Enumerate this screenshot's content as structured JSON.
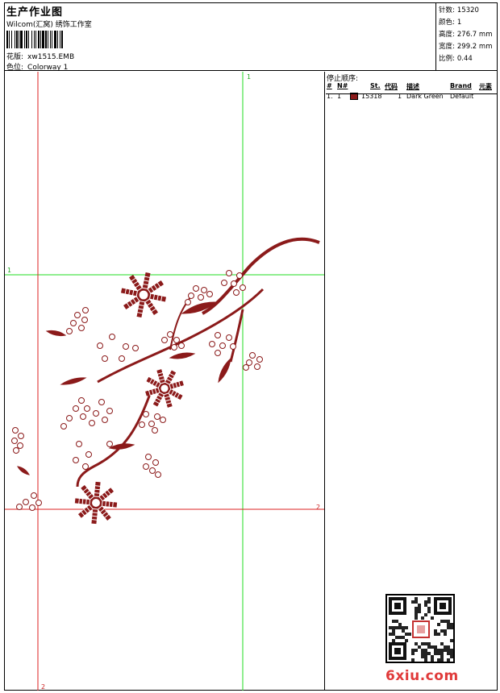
{
  "header": {
    "title": "生产作业图",
    "subtitle": "Wilcom(汇窝) 绣饰工作室",
    "pattern_label": "花版:",
    "pattern_value": "xw1515.EMB",
    "colorway_label": "色位:",
    "colorway_value": "Colorway 1"
  },
  "stats": [
    {
      "label": "针数:",
      "value": "15320"
    },
    {
      "label": "颜色:",
      "value": "1"
    },
    {
      "label": "高度:",
      "value": "276.7 mm"
    },
    {
      "label": "宽度:",
      "value": "299.2 mm"
    },
    {
      "label": "比例:",
      "value": "0.44"
    }
  ],
  "guides": {
    "top_marker": "1",
    "left_marker": "1",
    "right_marker": "2",
    "bottom_marker": "2"
  },
  "stop_sequence": {
    "title": "停止顺序:",
    "columns": [
      "#",
      "N#",
      "St.",
      "代码",
      "描述",
      "Brand",
      "元素"
    ],
    "rows": [
      {
        "index": "1.",
        "needle": "1",
        "swatch_color": "#8b1a1a",
        "stitches": "15318",
        "code": "1",
        "description": "Dark Green",
        "brand": "Default",
        "element": ""
      }
    ]
  },
  "colors": {
    "thread": "#8b1a1a",
    "guide_green": "#22dd22",
    "guide_red": "#dd2222"
  },
  "logo": {
    "brand_text": "6xiu.com"
  }
}
